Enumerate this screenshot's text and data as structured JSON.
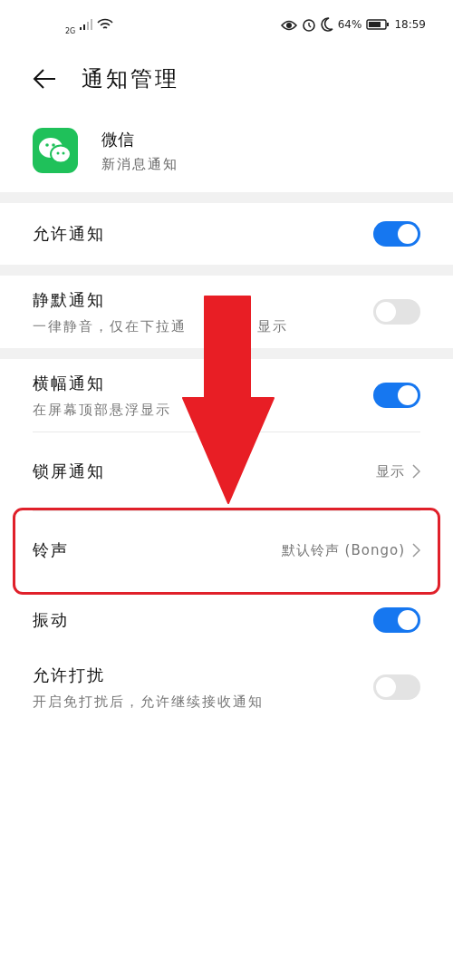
{
  "status_bar": {
    "network": "2G",
    "battery": "64%",
    "time": "18:59"
  },
  "header": {
    "title": "通知管理"
  },
  "app": {
    "name": "微信",
    "subtitle": "新消息通知"
  },
  "sections": [
    {
      "rows": [
        {
          "kind": "switch",
          "label": "允许通知",
          "on": true,
          "highlighted": false
        }
      ]
    },
    {
      "rows": [
        {
          "kind": "switch",
          "label": "静默通知",
          "subtitle": "一律静音，仅在下拉通",
          "subtitle_tail": "显示",
          "on": false,
          "highlighted": false
        }
      ]
    },
    {
      "rows": [
        {
          "kind": "switch",
          "label": "横幅通知",
          "subtitle": "在屏幕顶部悬浮显示",
          "on": true,
          "highlighted": false
        },
        {
          "kind": "value",
          "label": "锁屏通知",
          "value": "显示",
          "highlighted": false
        },
        {
          "kind": "value",
          "label": "铃声",
          "value": "默认铃声 (Bongo)",
          "highlighted": true
        },
        {
          "kind": "switch",
          "label": "振动",
          "on": true,
          "highlighted": false
        },
        {
          "kind": "switch",
          "label": "允许打扰",
          "subtitle": "开启免打扰后，允许继续接收通知",
          "on": false,
          "highlighted": false
        }
      ]
    }
  ]
}
